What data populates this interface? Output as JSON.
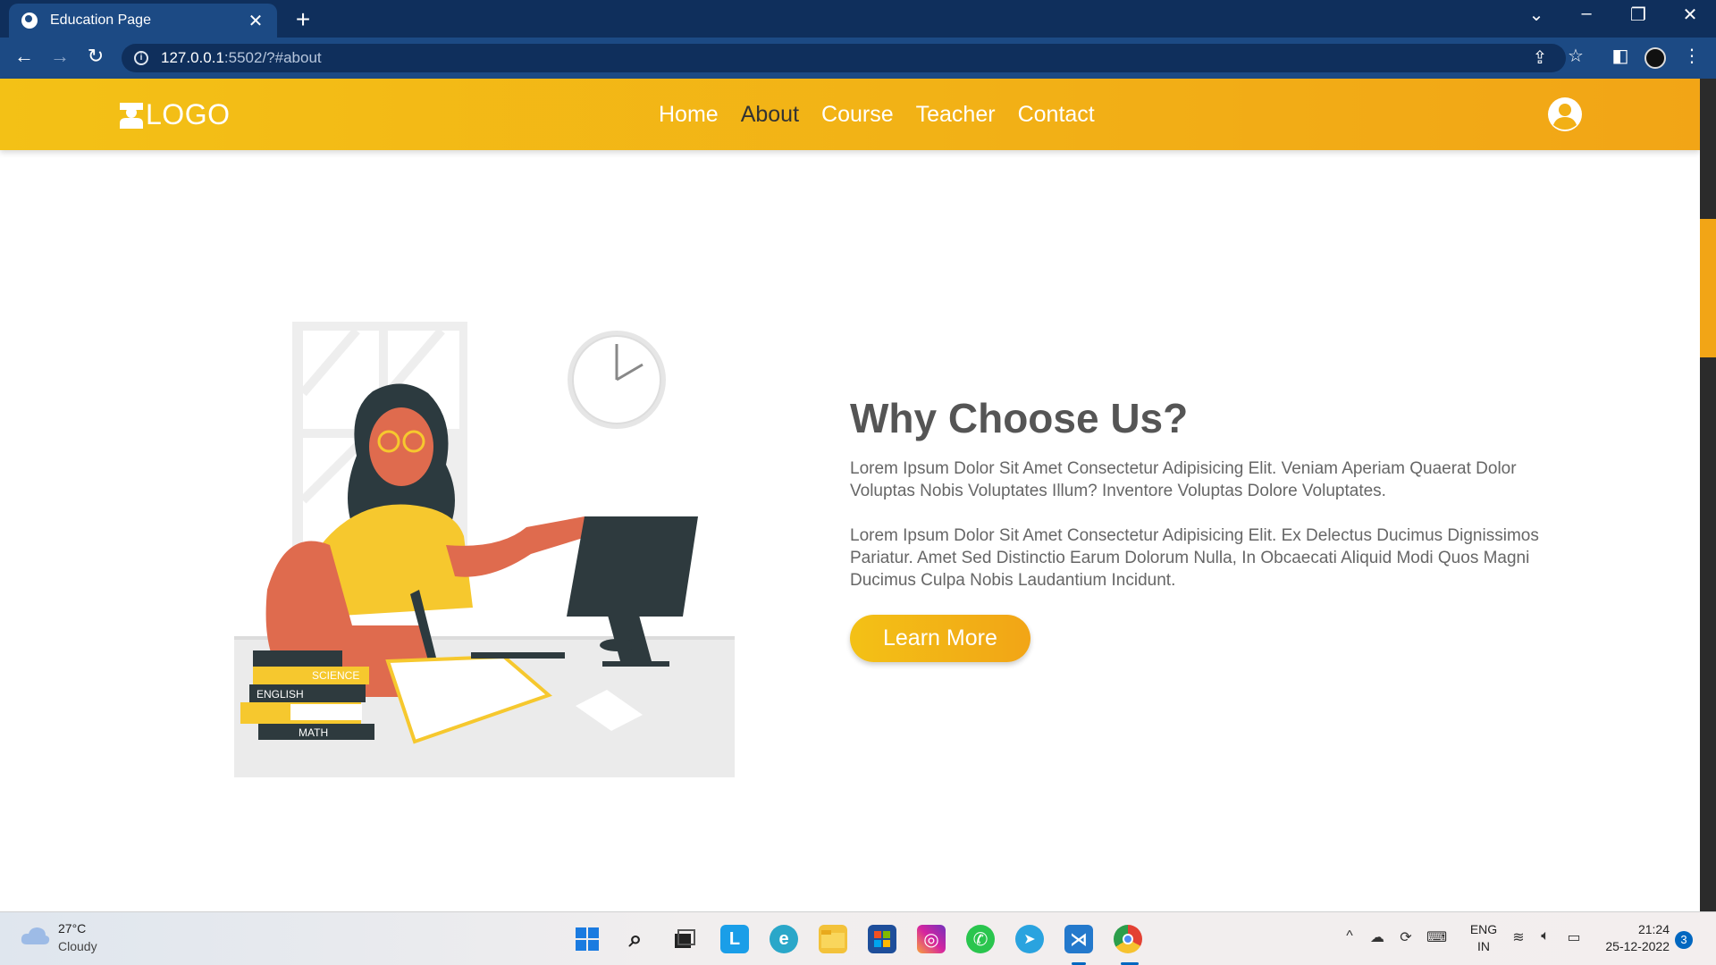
{
  "browser": {
    "tab_title": "Education Page",
    "tab_close": "✕",
    "new_tab": "+",
    "url_host": "127.0.0.1",
    "url_path": ":5502/?#about"
  },
  "site": {
    "logo_text": "LOGO",
    "nav": [
      "Home",
      "About",
      "Course",
      "Teacher",
      "Contact"
    ],
    "active_nav": "About",
    "accent_start": "#f3c116",
    "accent_end": "#f2a516"
  },
  "about": {
    "heading": "Why Choose Us?",
    "para1": "Lorem Ipsum Dolor Sit Amet Consectetur Adipisicing Elit. Veniam Aperiam Quaerat Dolor Voluptas Nobis Voluptates Illum? Inventore Voluptas Dolore Voluptates.",
    "para2": "Lorem Ipsum Dolor Sit Amet Consectetur Adipisicing Elit. Ex Delectus Ducimus Dignissimos Pariatur. Amet Sed Distinctio Earum Dolorum Nulla, In Obcaecati Aliquid Modi Quos Magni Ducimus Culpa Nobis Laudantium Incidunt.",
    "button": "Learn More"
  },
  "illustration": {
    "book_labels": [
      "SCIENCE",
      "ENGLISH",
      "MATH"
    ]
  },
  "taskbar": {
    "temperature": "27°C",
    "condition": "Cloudy",
    "lang_top": "ENG",
    "lang_bottom": "IN",
    "time": "21:24",
    "date": "25-12-2022",
    "notifications": "3"
  }
}
